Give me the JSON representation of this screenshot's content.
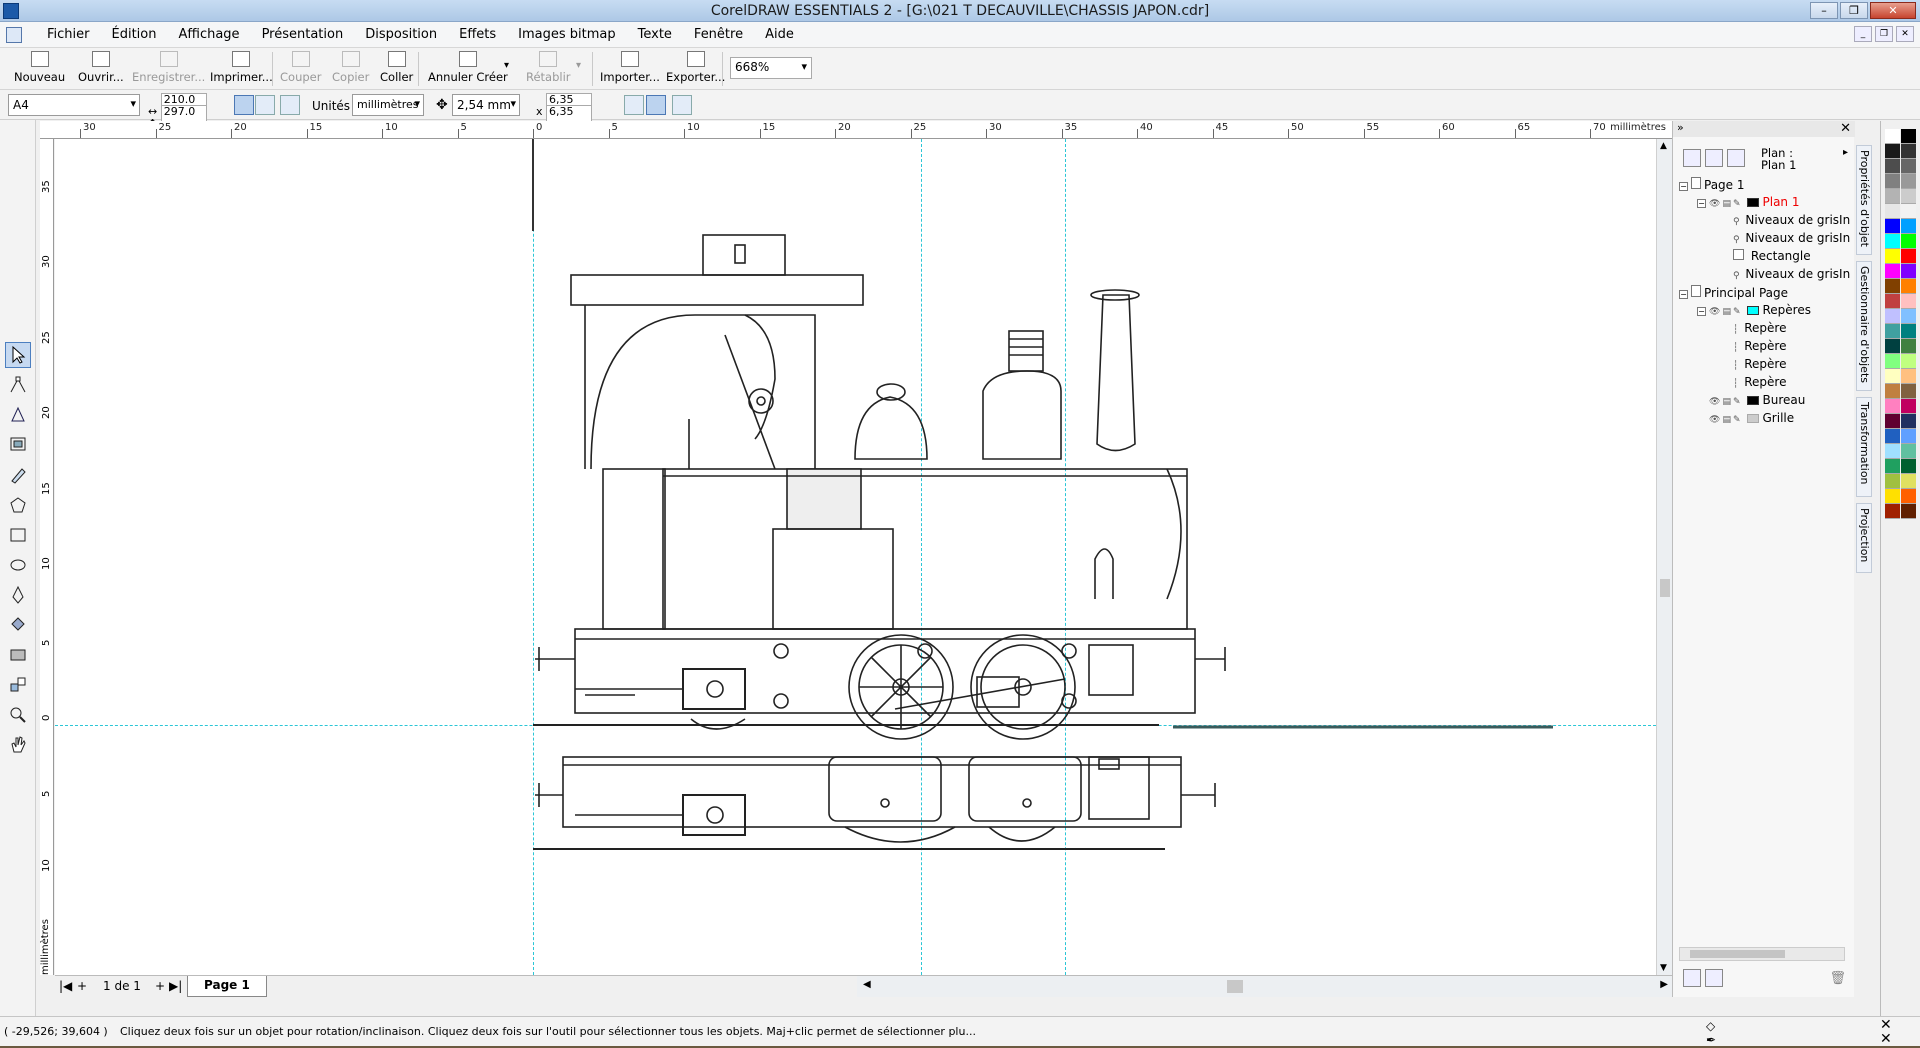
{
  "window": {
    "title": "CorelDRAW ESSENTIALS 2 - [G:\\021 T DECAUVILLE\\CHASSIS JAPON.cdr]"
  },
  "menu": [
    "Fichier",
    "Édition",
    "Affichage",
    "Présentation",
    "Disposition",
    "Effets",
    "Images bitmap",
    "Texte",
    "Fenêtre",
    "Aide"
  ],
  "toolbar": {
    "nouveau": "Nouveau",
    "ouvrir": "Ouvrir...",
    "enregistrer": "Enregistrer...",
    "imprimer": "Imprimer...",
    "couper": "Couper",
    "copier": "Copier",
    "coller": "Coller",
    "annuler": "Annuler Créer",
    "retablir": "Rétablir",
    "importer": "Importer...",
    "exporter": "Exporter...",
    "zoom": "668%"
  },
  "props": {
    "page_size": "A4",
    "width": "210.0 m",
    "height": "297.0 m",
    "units_label": "Unités :",
    "units": "millimètres",
    "nudge": "2,54 mm",
    "dup_x": "6,35 mm",
    "dup_y": "6,35 mm"
  },
  "ruler": {
    "unit": "millimètres",
    "top_labels": [
      "30",
      "25",
      "20",
      "15",
      "10",
      "5",
      "0",
      "5",
      "10",
      "15",
      "20",
      "25",
      "30",
      "35",
      "40",
      "45",
      "50",
      "55",
      "60",
      "65",
      "70"
    ],
    "left_labels": [
      "35",
      "30",
      "25",
      "20",
      "15",
      "10",
      "5",
      "0",
      "5",
      "10"
    ]
  },
  "pages": {
    "count": "1 de 1",
    "tab": "Page 1"
  },
  "status": {
    "coords": "( -29,526; 39,604 )",
    "message": "Cliquez deux fois sur un objet pour rotation/inclinaison. Cliquez deux fois sur l'outil pour sélectionner tous les objets. Maj+clic permet de sélectionner plu..."
  },
  "docker": {
    "plan_label": "Plan :",
    "plan_value": "Plan 1",
    "tree": {
      "page1": "Page 1",
      "plan1": "Plan 1",
      "n1": "Niveaux de grisIn",
      "n2": "Niveaux de grisIn",
      "rect": "Rectangle",
      "n3": "Niveaux de grisIn",
      "principal": "Principal Page",
      "reperes": "Repères",
      "r1": "Repère",
      "r2": "Repère",
      "r3": "Repère",
      "r4": "Repère",
      "bureau": "Bureau",
      "grille": "Grille"
    },
    "tabs": [
      "Propriétés d'objet",
      "Gestionnaire d'objets",
      "Transformation",
      "Projection"
    ]
  },
  "colors": {
    "guide": "#2cc6d6",
    "active_layer": "#e00000",
    "palette": [
      "#ffffff",
      "#000000",
      "#1a1a1a",
      "#333333",
      "#4d4d4d",
      "#666666",
      "#808080",
      "#999999",
      "#b3b3b3",
      "#cccccc",
      "#e6e6e6",
      "#f2f2f2",
      "#0000ff",
      "#00a0ff",
      "#00ffff",
      "#00ff00",
      "#ffff00",
      "#ff0000",
      "#ff00ff",
      "#8000ff",
      "#804000",
      "#ff8000",
      "#c04040",
      "#ffc0c0",
      "#c0c0ff",
      "#80c0ff",
      "#40a0a0",
      "#008080",
      "#004040",
      "#408040",
      "#80ff80",
      "#c0ff80",
      "#ffffc0",
      "#ffc080",
      "#c08040",
      "#806040",
      "#ff80c0",
      "#c00060",
      "#600030",
      "#203060",
      "#2060c0",
      "#60a0ff",
      "#a0e0ff",
      "#60c0a0",
      "#20a060",
      "#006030",
      "#a0c040",
      "#e0e060",
      "#ffe000",
      "#ff6000",
      "#a02000",
      "#602000"
    ]
  }
}
